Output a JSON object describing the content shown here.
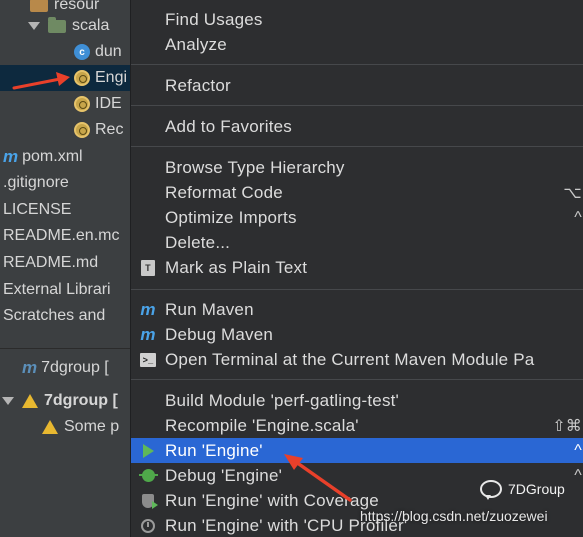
{
  "tree": {
    "items": [
      {
        "label": "resour",
        "kind": "folder"
      },
      {
        "label": "scala",
        "kind": "folder"
      },
      {
        "label": "dun",
        "kind": "class"
      },
      {
        "label": "Engi",
        "kind": "object",
        "selected": true
      },
      {
        "label": "IDE",
        "kind": "object"
      },
      {
        "label": "Rec",
        "kind": "object"
      },
      {
        "label": "pom.xml",
        "kind": "maven"
      },
      {
        "label": ".gitignore",
        "kind": "file"
      },
      {
        "label": "LICENSE",
        "kind": "file"
      },
      {
        "label": "README.en.mc",
        "kind": "file"
      },
      {
        "label": "README.md",
        "kind": "file"
      },
      {
        "label": "External Librari",
        "kind": "file"
      },
      {
        "label": "Scratches and",
        "kind": "file"
      }
    ],
    "bottom": [
      {
        "label": "7dgroup [",
        "kind": "maven"
      },
      {
        "label": "7dgroup [",
        "kind": "warn-bold"
      },
      {
        "label": "Some p",
        "kind": "warn"
      }
    ]
  },
  "menu": {
    "items": [
      {
        "label": "Find Usages",
        "shortcut": "",
        "icon": ""
      },
      {
        "label": "Analyze",
        "shortcut": "",
        "icon": ""
      },
      {
        "label": "Refactor",
        "shortcut": "",
        "icon": ""
      },
      {
        "label": "Add to Favorites",
        "shortcut": "",
        "icon": ""
      },
      {
        "label": "Browse Type Hierarchy",
        "shortcut": "",
        "icon": ""
      },
      {
        "label": "Reformat Code",
        "shortcut": "⌥",
        "icon": ""
      },
      {
        "label": "Optimize Imports",
        "shortcut": "^",
        "icon": ""
      },
      {
        "label": "Delete...",
        "shortcut": "",
        "icon": ""
      },
      {
        "label": "Mark as Plain Text",
        "shortcut": "",
        "icon": "plain-text-icon"
      },
      {
        "label": "Run Maven",
        "shortcut": "",
        "icon": "maven-run-icon"
      },
      {
        "label": "Debug Maven",
        "shortcut": "",
        "icon": "maven-debug-icon"
      },
      {
        "label": "Open Terminal at the Current Maven Module Pa",
        "shortcut": "",
        "icon": "terminal-icon"
      },
      {
        "label": "Build Module 'perf-gatling-test'",
        "shortcut": "",
        "icon": ""
      },
      {
        "label": "Recompile 'Engine.scala'",
        "shortcut": "⇧⌘",
        "icon": ""
      },
      {
        "label": "Run 'Engine'",
        "shortcut": "^",
        "icon": "run-icon",
        "highlighted": true
      },
      {
        "label": "Debug 'Engine'",
        "shortcut": "^",
        "icon": "debug-icon"
      },
      {
        "label": "Run 'Engine' with Coverage",
        "shortcut": "",
        "icon": "coverage-icon"
      },
      {
        "label": "Run 'Engine' with 'CPU Profiler'",
        "shortcut": "",
        "icon": "profiler-icon"
      }
    ]
  },
  "watermark": {
    "url": "https://blog.csdn.net/zuozewei",
    "brand": "7DGroup"
  },
  "colors": {
    "highlight": "#2a67d4",
    "annotation_arrow": "#e8402a",
    "run_green": "#5fb85a"
  }
}
